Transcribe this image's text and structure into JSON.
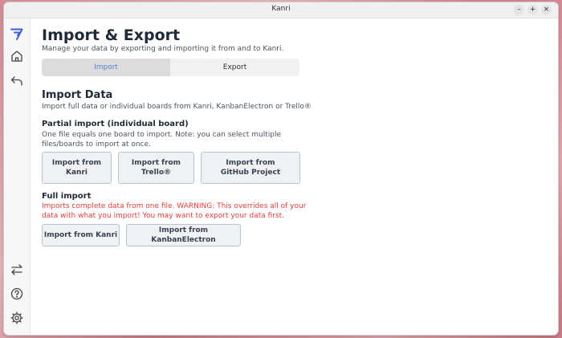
{
  "window": {
    "title": "Kanri",
    "controls": {
      "minimize": "–",
      "maximize": "+",
      "close": "×"
    }
  },
  "sidebar": {
    "icons": [
      "kanri-logo-icon",
      "home-icon",
      "back-icon",
      "swap-icon",
      "help-icon",
      "settings-icon"
    ]
  },
  "header": {
    "title": "Import & Export",
    "subtitle": "Manage your data by exporting and importing it from and to Kanri."
  },
  "tabs": [
    {
      "label": "Import",
      "active": true
    },
    {
      "label": "Export",
      "active": false
    }
  ],
  "import_section": {
    "title": "Import Data",
    "description": "Import full data or individual boards from Kanri, KanbanElectron or Trello®",
    "partial": {
      "title": "Partial import (individual board)",
      "description": "One file equals one board to import. Note: you can select multiple files/boards to import at once.",
      "buttons": [
        "Import from Kanri",
        "Import from Trello®",
        "Import from GitHub Project"
      ]
    },
    "full": {
      "title": "Full import",
      "warning": "Imports complete data from one file. WARNING: This overrides all of your data with what you import! You may want to export your data first.",
      "buttons": [
        "Import from Kanri",
        "Import from KanbanElectron"
      ]
    }
  },
  "colors": {
    "accent": "#5b7fd6",
    "warning": "#e0403a",
    "logo": "#3b5bdb"
  }
}
